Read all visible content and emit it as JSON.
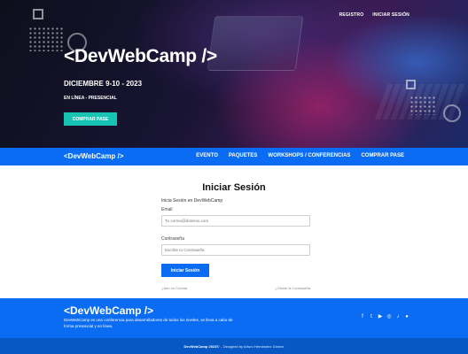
{
  "hero": {
    "top_links": [
      "REGISTRO",
      "INICIAR SESIÓN"
    ],
    "logo": "<DevWebCamp />",
    "date": "DICIEMBRE 9-10 - 2023",
    "mode": "EN LÍNEA - PRESENCIAL",
    "cta_label": "COMPRAR PASE"
  },
  "nav": {
    "logo": "<DevWebCamp />",
    "links": [
      "EVENTO",
      "PAQUETES",
      "WORKSHOPS / CONFERENCIAS",
      "COMPRAR PASE"
    ]
  },
  "login": {
    "title": "Iniciar Sesión",
    "intro": "Inicia Sesión en DevWebCamp",
    "email_label": "Email",
    "email_placeholder": "Tu correo@dominio.com",
    "password_label": "Contraseña",
    "password_placeholder": "Escribe tu Contraseña",
    "submit_label": "Iniciar Sesión",
    "create_account": "¿Aún no Cuenta",
    "forgot_password": "¿Olvidé la Contraseña"
  },
  "footer": {
    "logo": "<DevWebCamp />",
    "description": "DevWebCamp es una conferencia para desarrolladores de todos los niveles, se lleva a cabo de forma presencial y en línea.",
    "social_icons": [
      "facebook-icon",
      "twitter-icon",
      "youtube-icon",
      "instagram-icon",
      "tiktok-icon",
      "github-icon"
    ],
    "social_glyphs": [
      "f",
      "t",
      "▶",
      "◎",
      "♪",
      "●"
    ],
    "copyright_brand": "DevWebCamp 2023©",
    "copyright_rest": "- Designed by Arturo Hernández Gómez"
  },
  "colors": {
    "primary_blue": "#0a6cf2",
    "accent_teal": "#17c3b2",
    "bottom_bar": "#0757c4"
  }
}
